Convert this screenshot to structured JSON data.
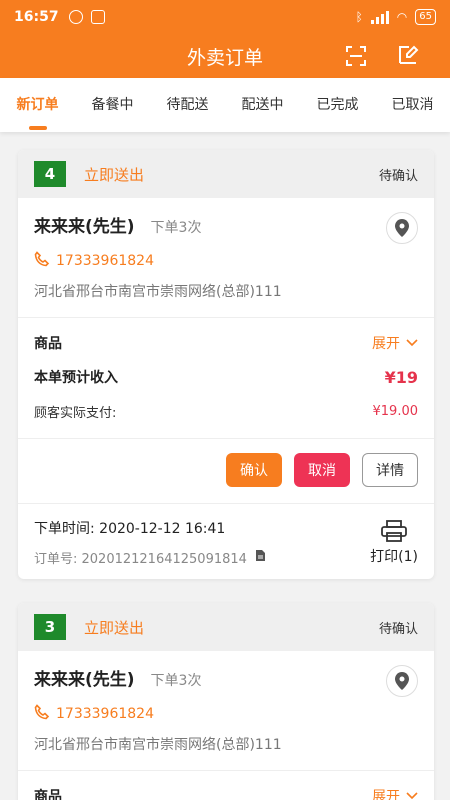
{
  "status_bar": {
    "time": "16:57",
    "battery": "65"
  },
  "header": {
    "title": "外卖订单"
  },
  "tabs": [
    "新订单",
    "备餐中",
    "待配送",
    "配送中",
    "已完成",
    "已取消"
  ],
  "orders": [
    {
      "number": "4",
      "delivery_type": "立即送出",
      "status": "待确认",
      "customer_name": "来来来(先生)",
      "order_count": "下单3次",
      "phone": "17333961824",
      "address": "河北省邢台市南宫市崇雨网络(总部)111",
      "goods_label": "商品",
      "expand_label": "展开",
      "income_label": "本单预计收入",
      "income": "¥19",
      "paid_label": "顾客实际支付:",
      "paid": "¥19.00",
      "buttons": {
        "confirm": "确认",
        "cancel": "取消",
        "detail": "详情"
      },
      "order_time": "下单时间: 2020-12-12 16:41",
      "order_no": "订单号: 20201212164125091814",
      "print_label": "打印(1)"
    },
    {
      "number": "3",
      "delivery_type": "立即送出",
      "status": "待确认",
      "customer_name": "来来来(先生)",
      "order_count": "下单3次",
      "phone": "17333961824",
      "address": "河北省邢台市南宫市崇雨网络(总部)111",
      "goods_label": "商品",
      "expand_label": "展开"
    }
  ],
  "colors": {
    "accent": "#f77d1f",
    "badge": "#1f8a2b",
    "danger": "#ee3355"
  }
}
